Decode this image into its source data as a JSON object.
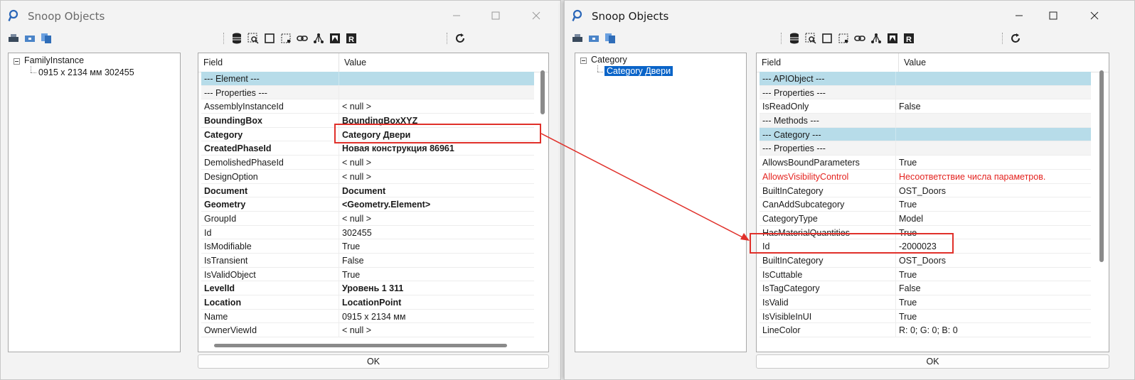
{
  "left_window": {
    "title": "Snoop Objects",
    "tree": {
      "root": "FamilyInstance",
      "child": "0915 x 2134 мм  302455"
    },
    "columns": {
      "field": "Field",
      "value": "Value"
    },
    "rows": [
      {
        "field": "--- Element ---",
        "value": "",
        "kind": "section"
      },
      {
        "field": "--- Properties ---",
        "value": "",
        "kind": "group"
      },
      {
        "field": "AssemblyInstanceId",
        "value": "< null >",
        "kind": "normal"
      },
      {
        "field": "BoundingBox",
        "value": "BoundingBoxXYZ",
        "kind": "bold"
      },
      {
        "field": "Category",
        "value": "Category  Двери",
        "kind": "bold"
      },
      {
        "field": "CreatedPhaseId",
        "value": "Новая конструкция  86961",
        "kind": "bold"
      },
      {
        "field": "DemolishedPhaseId",
        "value": "< null >",
        "kind": "normal"
      },
      {
        "field": "DesignOption",
        "value": "< null >",
        "kind": "normal"
      },
      {
        "field": "Document",
        "value": "Document",
        "kind": "bold"
      },
      {
        "field": "Geometry",
        "value": "<Geometry.Element>",
        "kind": "bold"
      },
      {
        "field": "GroupId",
        "value": "< null >",
        "kind": "normal"
      },
      {
        "field": "Id",
        "value": "302455",
        "kind": "normal"
      },
      {
        "field": "IsModifiable",
        "value": "True",
        "kind": "normal"
      },
      {
        "field": "IsTransient",
        "value": "False",
        "kind": "normal"
      },
      {
        "field": "IsValidObject",
        "value": "True",
        "kind": "normal"
      },
      {
        "field": "LevelId",
        "value": "Уровень 1  311",
        "kind": "bold"
      },
      {
        "field": "Location",
        "value": "LocationPoint",
        "kind": "bold"
      },
      {
        "field": "Name",
        "value": "0915 x 2134 мм",
        "kind": "normal"
      },
      {
        "field": "OwnerViewId",
        "value": "< null >",
        "kind": "normal"
      }
    ],
    "ok_label": "OK"
  },
  "right_window": {
    "title": "Snoop Objects",
    "tree": {
      "root": "Category",
      "child": "Category  Двери"
    },
    "columns": {
      "field": "Field",
      "value": "Value"
    },
    "rows": [
      {
        "field": "--- APIObject ---",
        "value": "",
        "kind": "section"
      },
      {
        "field": "--- Properties ---",
        "value": "",
        "kind": "group"
      },
      {
        "field": "IsReadOnly",
        "value": "False",
        "kind": "normal"
      },
      {
        "field": "--- Methods ---",
        "value": "",
        "kind": "group"
      },
      {
        "field": "--- Category ---",
        "value": "",
        "kind": "section"
      },
      {
        "field": "--- Properties ---",
        "value": "",
        "kind": "group"
      },
      {
        "field": "AllowsBoundParameters",
        "value": "True",
        "kind": "normal"
      },
      {
        "field": "AllowsVisibilityControl",
        "value": "Несоответствие числа параметров.",
        "kind": "error"
      },
      {
        "field": "BuiltInCategory",
        "value": "OST_Doors",
        "kind": "normal"
      },
      {
        "field": "CanAddSubcategory",
        "value": "True",
        "kind": "normal"
      },
      {
        "field": "CategoryType",
        "value": "Model",
        "kind": "normal"
      },
      {
        "field": "HasMaterialQuantities",
        "value": "True",
        "kind": "normal"
      },
      {
        "field": "Id",
        "value": "-2000023",
        "kind": "normal"
      },
      {
        "field": "BuiltInCategory",
        "value": "OST_Doors",
        "kind": "normal"
      },
      {
        "field": "IsCuttable",
        "value": "True",
        "kind": "normal"
      },
      {
        "field": "IsTagCategory",
        "value": "False",
        "kind": "normal"
      },
      {
        "field": "IsValid",
        "value": "True",
        "kind": "normal"
      },
      {
        "field": "IsVisibleInUI",
        "value": "True",
        "kind": "normal"
      },
      {
        "field": "LineColor",
        "value": "R: 0; G: 0; B: 0",
        "kind": "normal"
      }
    ],
    "ok_label": "OK"
  },
  "toolbar_icons": [
    "print-icon",
    "print-preview-icon",
    "copy-icon",
    "database-icon",
    "snoop-db-icon",
    "select-icon",
    "pick-icon",
    "link-icon",
    "dependents-icon",
    "snoop-view-icon",
    "revit-app-icon",
    "refresh-icon"
  ],
  "annotation_color": "#e0302a",
  "selection_color": "#0a64c8",
  "section_row_color": "#b7dce9"
}
